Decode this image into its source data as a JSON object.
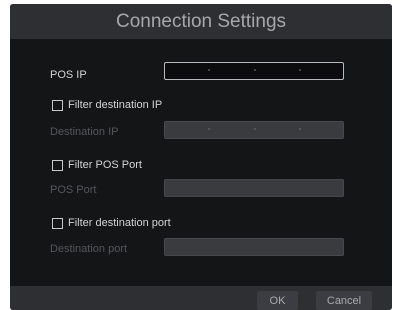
{
  "dialog": {
    "title": "Connection Settings"
  },
  "pos_ip": {
    "label": "POS IP"
  },
  "filter_destination_ip": {
    "checkbox_label": "Filter destination IP",
    "checked": false,
    "field_label": "Destination IP"
  },
  "filter_pos_port": {
    "checkbox_label": "Filter POS Port",
    "checked": false,
    "field_label": "POS Port"
  },
  "filter_destination_port": {
    "checkbox_label": "Filter destination port",
    "checked": false,
    "field_label": "Destination port"
  },
  "footer": {
    "ok_label": "OK",
    "cancel_label": "Cancel"
  },
  "colors": {
    "dialog_background": "#141517",
    "titlebar_background": "#2e2f33",
    "enabled_text": "#d4d4d6",
    "disabled_text": "#55565a"
  }
}
